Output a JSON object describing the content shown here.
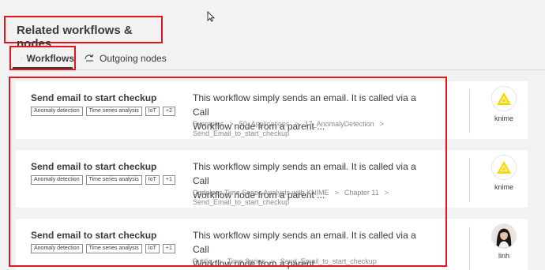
{
  "section": {
    "title": "Related workflows & nodes"
  },
  "tabs": [
    {
      "label": "Workflows",
      "icon": "workflow-icon",
      "active": true
    },
    {
      "label": "Outgoing nodes",
      "icon": "outgoing-nodes-icon",
      "active": false
    }
  ],
  "cards": [
    {
      "title": "Send email to start checkup",
      "tags": [
        "Anomaly detection",
        "Time series analysis",
        "IoT",
        "+2"
      ],
      "description_line1": "This workflow simply sends an email. It is called via a Call",
      "description_line2": "Workflow node from a parent ...",
      "breadcrumbs": [
        "Examples",
        "50_Applications",
        "17_AnomalyDetection",
        "Send_Email_to_start_checkup"
      ],
      "owner": "knime",
      "avatar": "knime-logo-icon"
    },
    {
      "title": "Send email to start checkup",
      "tags": [
        "Anomaly detection",
        "Time series analysis",
        "IoT",
        "+1"
      ],
      "description_line1": "This workflow simply sends an email. It is called via a Call",
      "description_line2": "Workflow node from a parent ...",
      "breadcrumbs": [
        "Codeless Time Series Analysis with KNIME",
        "Chapter 11",
        "Send_Email_to_start_checkup"
      ],
      "owner": "knime",
      "avatar": "knime-logo-icon"
    },
    {
      "title": "Send email to start checkup",
      "tags": [
        "Anomaly detection",
        "Time series analysis",
        "IoT",
        "+1"
      ],
      "description_line1": "This workflow simply sends an email. It is called via a Call",
      "description_line2": "Workflow node from a parent ...",
      "breadcrumbs": [
        "Public",
        "Time Series",
        "Send_Email_to_start_checkup"
      ],
      "owner": "linh",
      "avatar": "user-photo-avatar"
    }
  ],
  "colors": {
    "highlight": "#e4161c",
    "knime_yellow": "#fdd800",
    "text": "#3e3a39",
    "muted": "#8a8a8a"
  }
}
